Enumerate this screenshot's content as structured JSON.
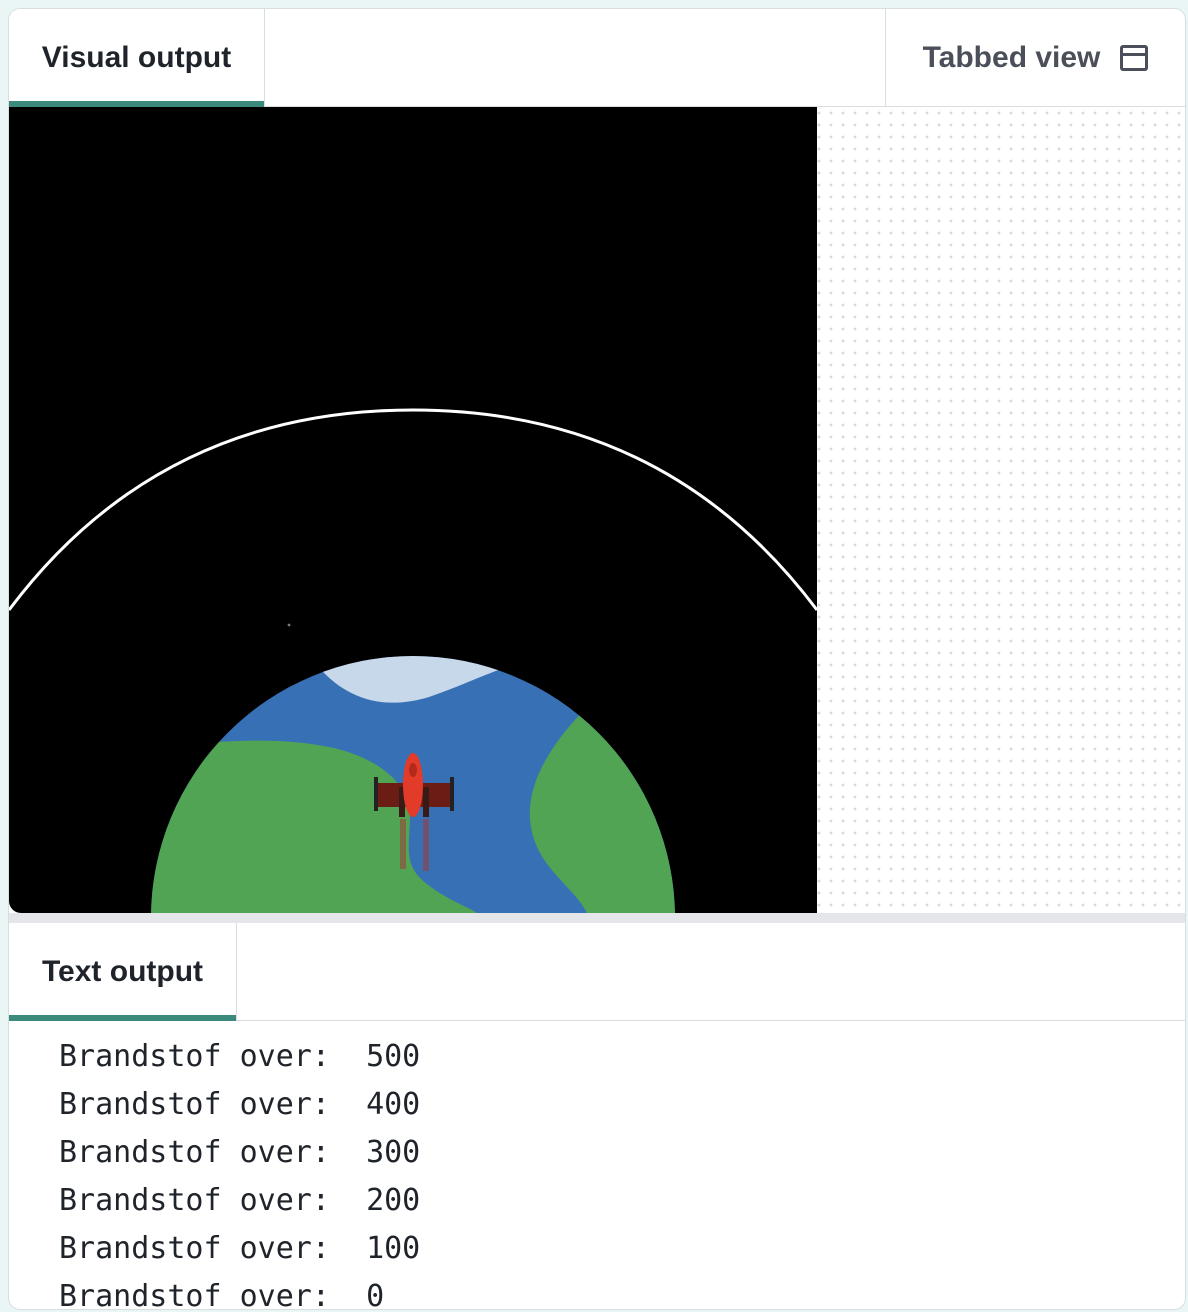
{
  "tabs": {
    "visual_output": "Visual output",
    "tabbed_view": "Tabbed view",
    "text_output": "Text output"
  },
  "icons": {
    "tabbed_view": "window-icon"
  },
  "colors": {
    "accent": "#3b8a7c",
    "space": "#000000",
    "ocean": "#3770b5",
    "land": "#52a455",
    "ice": "#c6d8ea",
    "rocket": "#e23b2a"
  },
  "console": {
    "lines": [
      {
        "label": "Brandstof over:",
        "value": "500"
      },
      {
        "label": "Brandstof over:",
        "value": "400"
      },
      {
        "label": "Brandstof over:",
        "value": "300"
      },
      {
        "label": "Brandstof over:",
        "value": "200"
      },
      {
        "label": "Brandstof over:",
        "value": "100"
      },
      {
        "label": "Brandstof over:",
        "value": "0"
      }
    ]
  }
}
